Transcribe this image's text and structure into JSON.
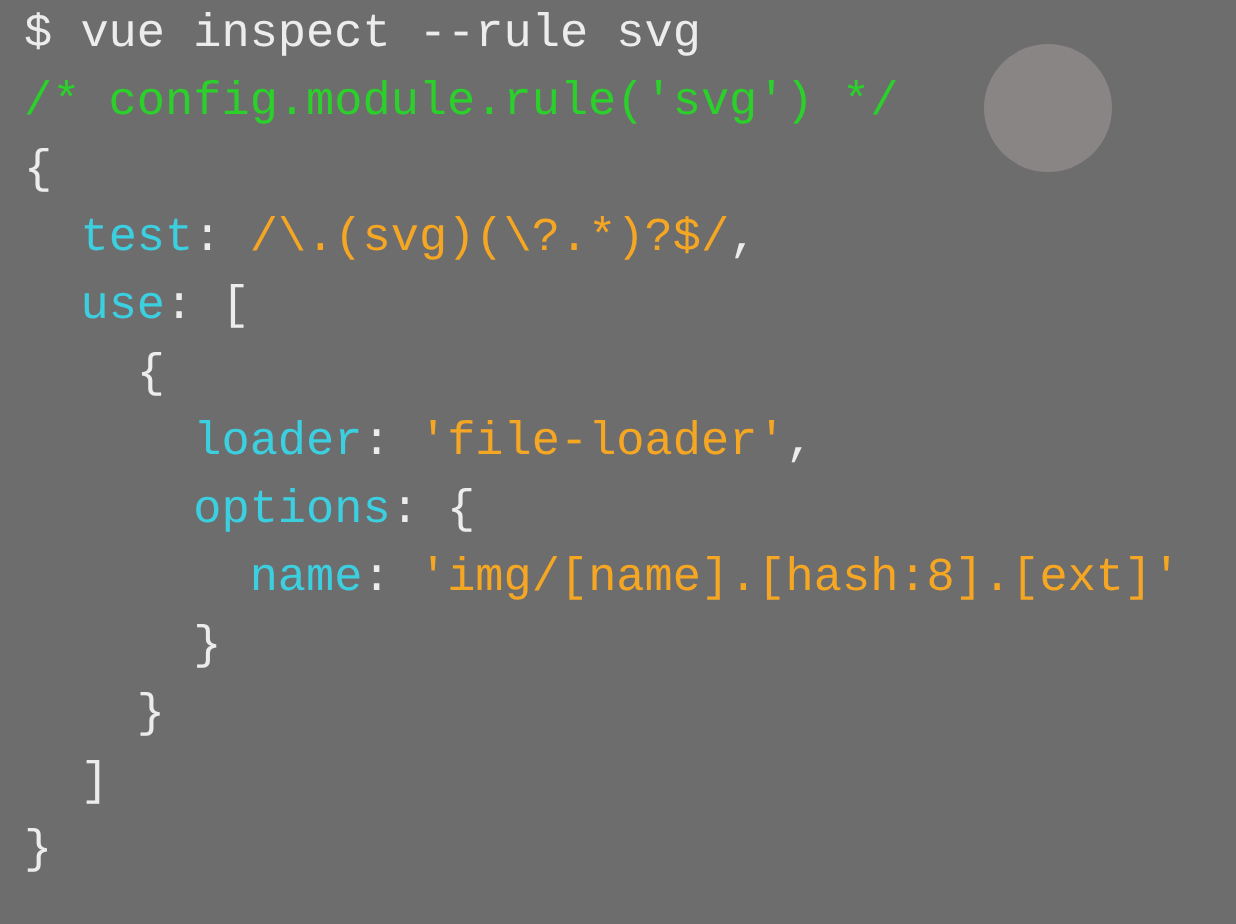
{
  "terminal": {
    "lines": [
      {
        "tokens": [
          {
            "kind": "command",
            "text": "$ vue inspect --rule svg"
          }
        ]
      },
      {
        "tokens": [
          {
            "kind": "comment",
            "text": "/* config.module.rule('svg') */"
          }
        ]
      },
      {
        "tokens": [
          {
            "kind": "punct",
            "text": "{"
          }
        ]
      },
      {
        "tokens": [
          {
            "kind": "key",
            "text": "  test"
          },
          {
            "kind": "punct",
            "text": ": "
          },
          {
            "kind": "string",
            "text": "/\\.(svg)(\\?.*)?$/"
          },
          {
            "kind": "punct",
            "text": ","
          }
        ]
      },
      {
        "tokens": [
          {
            "kind": "key",
            "text": "  use"
          },
          {
            "kind": "punct",
            "text": ": ["
          }
        ]
      },
      {
        "tokens": [
          {
            "kind": "punct",
            "text": "    {"
          }
        ]
      },
      {
        "tokens": [
          {
            "kind": "key",
            "text": "      loader"
          },
          {
            "kind": "punct",
            "text": ": "
          },
          {
            "kind": "string",
            "text": "'file-loader'"
          },
          {
            "kind": "punct",
            "text": ","
          }
        ]
      },
      {
        "tokens": [
          {
            "kind": "key",
            "text": "      options"
          },
          {
            "kind": "punct",
            "text": ": {"
          }
        ]
      },
      {
        "tokens": [
          {
            "kind": "key",
            "text": "        name"
          },
          {
            "kind": "punct",
            "text": ": "
          },
          {
            "kind": "string",
            "text": "'img/[name].[hash:8].[ext]'"
          }
        ]
      },
      {
        "tokens": [
          {
            "kind": "punct",
            "text": "      }"
          }
        ]
      },
      {
        "tokens": [
          {
            "kind": "punct",
            "text": "    }"
          }
        ]
      },
      {
        "tokens": [
          {
            "kind": "punct",
            "text": "  ]"
          }
        ]
      },
      {
        "tokens": [
          {
            "kind": "punct",
            "text": "}"
          }
        ]
      }
    ]
  }
}
